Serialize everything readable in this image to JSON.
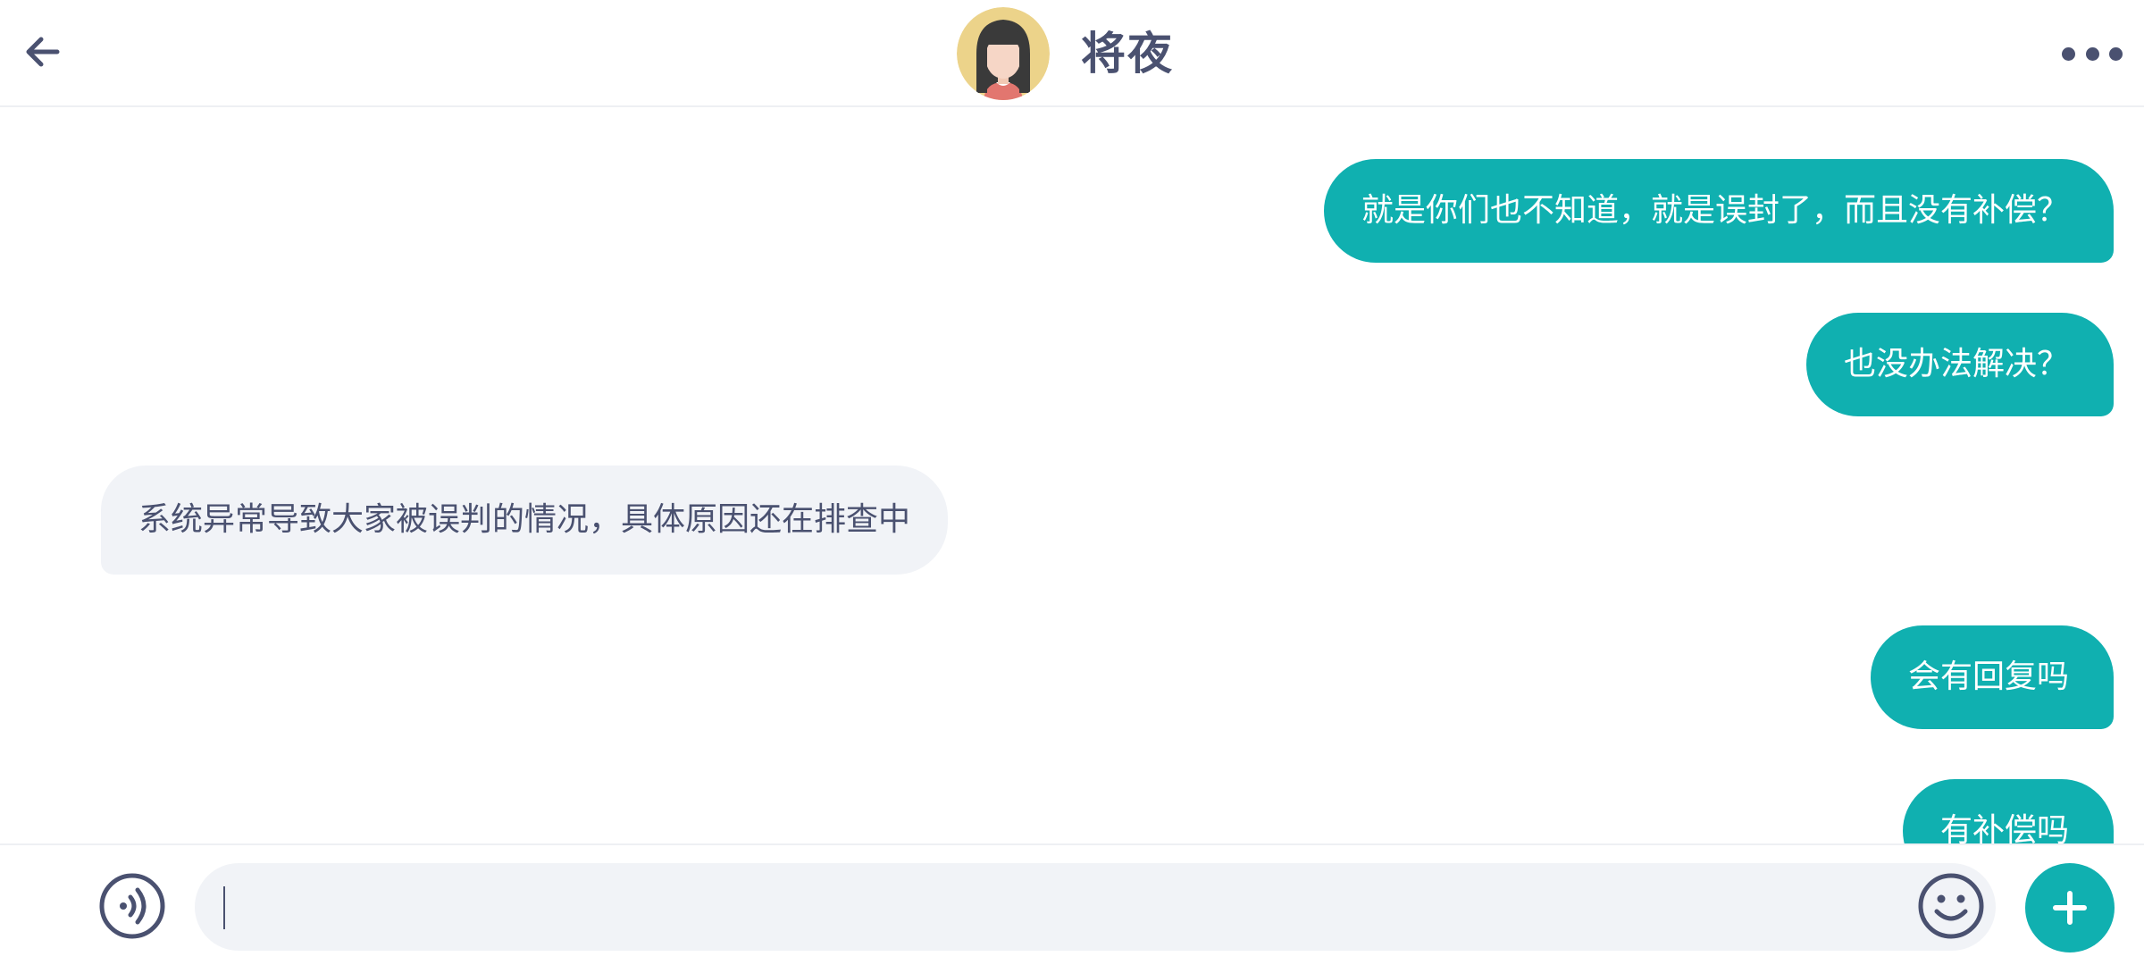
{
  "header": {
    "contact_name": "将夜",
    "back_icon": "arrow-left-icon",
    "more_icon": "more-horizontal-icon"
  },
  "messages": [
    {
      "direction": "outgoing",
      "text": "就是你们也不知道，就是误封了，而且没有补偿？"
    },
    {
      "direction": "outgoing",
      "text": "也没办法解决？"
    },
    {
      "direction": "incoming",
      "text": "系统异常导致大家被误判的情况，具体原因还在排查中"
    },
    {
      "direction": "outgoing",
      "text": "会有回复吗"
    },
    {
      "direction": "outgoing",
      "text": "有补偿吗"
    }
  ],
  "input": {
    "value": "",
    "placeholder": "",
    "voice_icon": "voice-icon",
    "emoji_icon": "emoji-icon",
    "plus_icon": "plus-icon"
  },
  "colors": {
    "accent": "#10b0b0",
    "text": "#4a5170",
    "incoming_bubble": "#f1f3f7",
    "input_bg": "#f1f3f7"
  }
}
